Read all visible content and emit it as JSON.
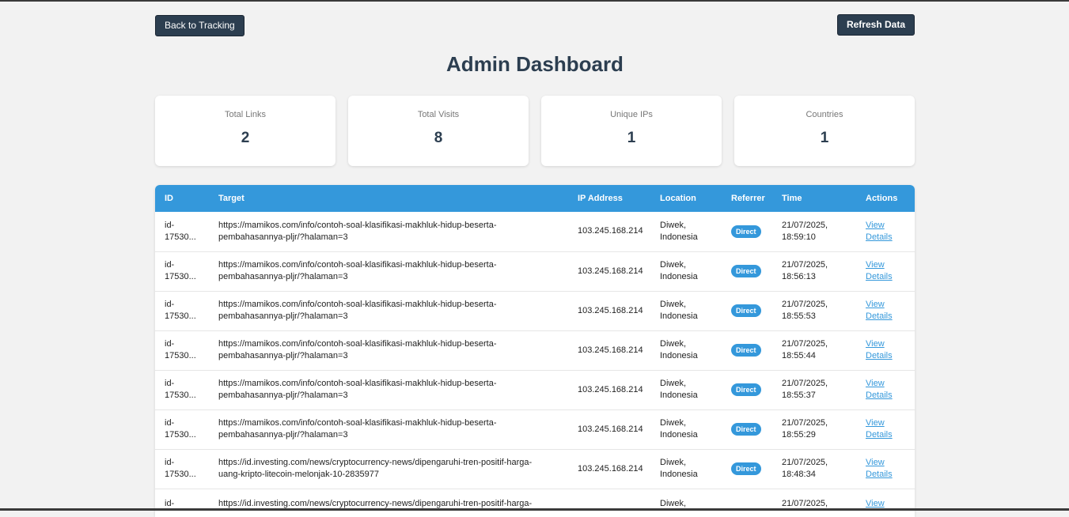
{
  "toolbar": {
    "back_label": "Back to Tracking",
    "refresh_label": "Refresh Data"
  },
  "page_title": "Admin Dashboard",
  "stats": [
    {
      "label": "Total Links",
      "value": "2"
    },
    {
      "label": "Total Visits",
      "value": "8"
    },
    {
      "label": "Unique IPs",
      "value": "1"
    },
    {
      "label": "Countries",
      "value": "1"
    }
  ],
  "table": {
    "headers": [
      "ID",
      "Target",
      "IP Address",
      "Location",
      "Referrer",
      "Time",
      "Actions"
    ],
    "action_label_1": "View",
    "action_label_2": "Details",
    "rows": [
      {
        "id_1": "id-",
        "id_2": "17530...",
        "target_1": "https://mamikos.com/info/contoh-soal-klasifikasi-makhluk-hidup-beserta-",
        "target_2": "pembahasannya-pljr/?halaman=3",
        "ip": "103.245.168.214",
        "loc_1": "Diwek,",
        "loc_2": "Indonesia",
        "referrer": "Direct",
        "time_1": "21/07/2025,",
        "time_2": "18:59:10"
      },
      {
        "id_1": "id-",
        "id_2": "17530...",
        "target_1": "https://mamikos.com/info/contoh-soal-klasifikasi-makhluk-hidup-beserta-",
        "target_2": "pembahasannya-pljr/?halaman=3",
        "ip": "103.245.168.214",
        "loc_1": "Diwek,",
        "loc_2": "Indonesia",
        "referrer": "Direct",
        "time_1": "21/07/2025,",
        "time_2": "18:56:13"
      },
      {
        "id_1": "id-",
        "id_2": "17530...",
        "target_1": "https://mamikos.com/info/contoh-soal-klasifikasi-makhluk-hidup-beserta-",
        "target_2": "pembahasannya-pljr/?halaman=3",
        "ip": "103.245.168.214",
        "loc_1": "Diwek,",
        "loc_2": "Indonesia",
        "referrer": "Direct",
        "time_1": "21/07/2025,",
        "time_2": "18:55:53"
      },
      {
        "id_1": "id-",
        "id_2": "17530...",
        "target_1": "https://mamikos.com/info/contoh-soal-klasifikasi-makhluk-hidup-beserta-",
        "target_2": "pembahasannya-pljr/?halaman=3",
        "ip": "103.245.168.214",
        "loc_1": "Diwek,",
        "loc_2": "Indonesia",
        "referrer": "Direct",
        "time_1": "21/07/2025,",
        "time_2": "18:55:44"
      },
      {
        "id_1": "id-",
        "id_2": "17530...",
        "target_1": "https://mamikos.com/info/contoh-soal-klasifikasi-makhluk-hidup-beserta-",
        "target_2": "pembahasannya-pljr/?halaman=3",
        "ip": "103.245.168.214",
        "loc_1": "Diwek,",
        "loc_2": "Indonesia",
        "referrer": "Direct",
        "time_1": "21/07/2025,",
        "time_2": "18:55:37"
      },
      {
        "id_1": "id-",
        "id_2": "17530...",
        "target_1": "https://mamikos.com/info/contoh-soal-klasifikasi-makhluk-hidup-beserta-",
        "target_2": "pembahasannya-pljr/?halaman=3",
        "ip": "103.245.168.214",
        "loc_1": "Diwek,",
        "loc_2": "Indonesia",
        "referrer": "Direct",
        "time_1": "21/07/2025,",
        "time_2": "18:55:29"
      },
      {
        "id_1": "id-",
        "id_2": "17530...",
        "target_1": "https://id.investing.com/news/cryptocurrency-news/dipengaruhi-tren-positif-harga-",
        "target_2": "uang-kripto-litecoin-melonjak-10-2835977",
        "ip": "103.245.168.214",
        "loc_1": "Diwek,",
        "loc_2": "Indonesia",
        "referrer": "Direct",
        "time_1": "21/07/2025,",
        "time_2": "18:48:34"
      },
      {
        "id_1": "id-",
        "id_2": "",
        "target_1": "https://id.investing.com/news/cryptocurrency-news/dipengaruhi-tren-positif-harga-",
        "target_2": "",
        "ip": "",
        "loc_1": "Diwek,",
        "loc_2": "",
        "referrer": "",
        "time_1": "21/07/2025,",
        "time_2": ""
      }
    ]
  },
  "colors": {
    "primary": "#2c3e50",
    "accent": "#3498db",
    "background": "#f2f2f2"
  }
}
